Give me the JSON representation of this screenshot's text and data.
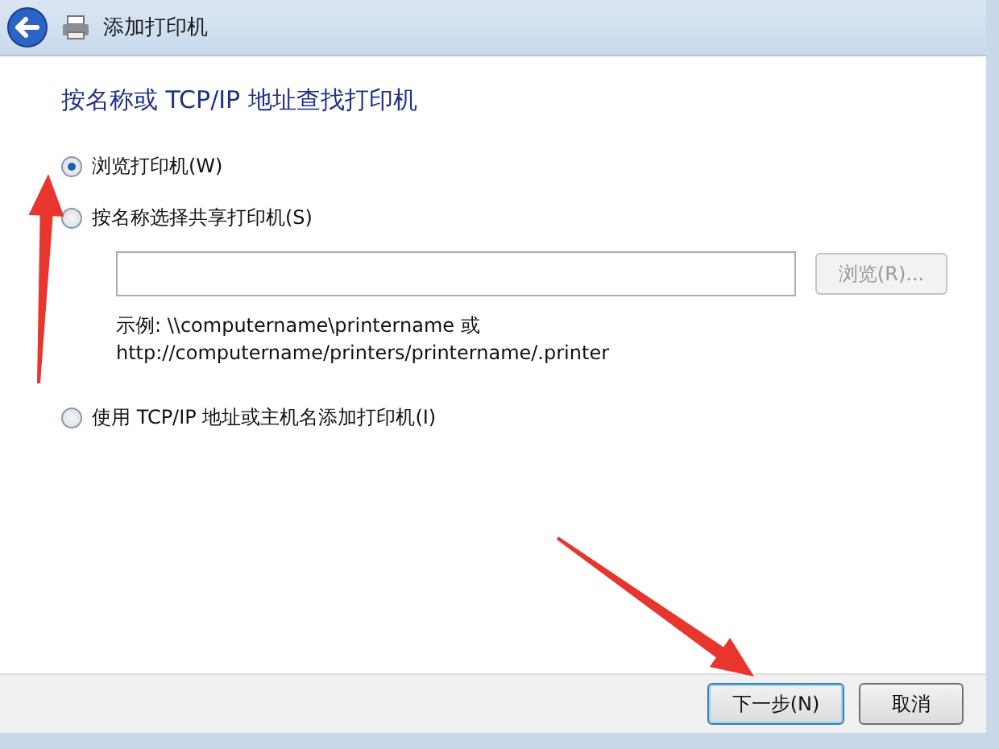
{
  "window": {
    "title": "添加打印机"
  },
  "heading": "按名称或 TCP/IP 地址查找打印机",
  "options": [
    {
      "label": "浏览打印机(W)",
      "selected": true
    },
    {
      "label": "按名称选择共享打印机(S)",
      "selected": false,
      "browse_button": {
        "label": "浏览(R)...",
        "disabled": true
      },
      "example": [
        "示例: \\\\computername\\printername 或",
        "http://computername/printers/printername/.printer"
      ]
    },
    {
      "label": "使用 TCP/IP 地址或主机名添加打印机(I)",
      "selected": false
    }
  ],
  "buttons": [
    {
      "label": "下一步(N)",
      "default": true
    },
    {
      "label": "取消",
      "default": false
    }
  ]
}
